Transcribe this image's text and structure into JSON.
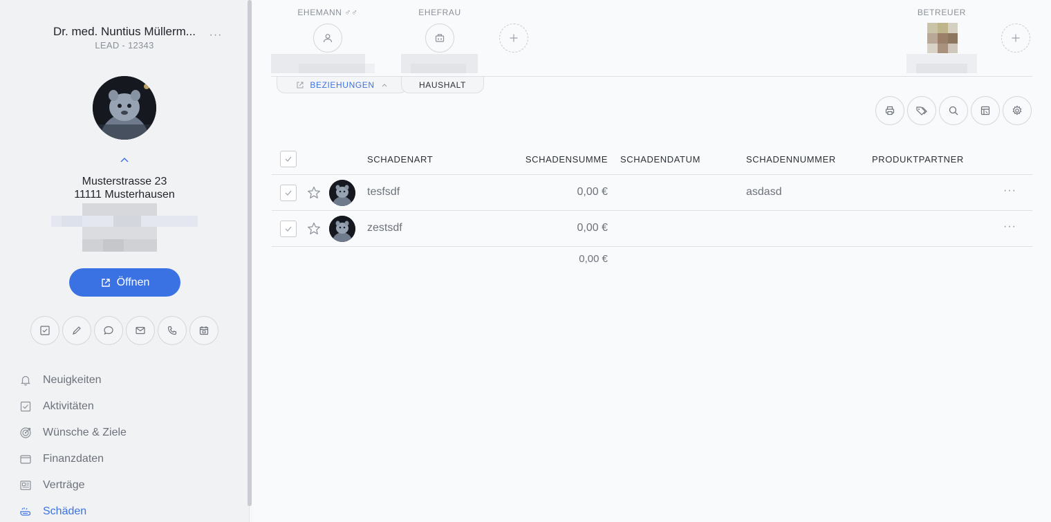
{
  "client": {
    "name": "Dr. med. Nuntius Müllerm...",
    "id": "LEAD - 12343",
    "street": "Musterstrasse 23",
    "city": "11111 Musterhausen",
    "open_label": "Öffnen"
  },
  "nav": {
    "items": [
      {
        "label": "Neuigkeiten",
        "icon": "bell-icon"
      },
      {
        "label": "Aktivitäten",
        "icon": "checkbox-icon"
      },
      {
        "label": "Wünsche & Ziele",
        "icon": "target-icon"
      },
      {
        "label": "Finanzdaten",
        "icon": "wallet-icon"
      },
      {
        "label": "Verträge",
        "icon": "contract-icon"
      },
      {
        "label": "Schäden",
        "icon": "damage-icon",
        "active": true
      }
    ]
  },
  "relations": {
    "husband_label": "EHEMANN ♂♂",
    "wife_label": "EHEFRAU",
    "advisor_label": "BETREUER"
  },
  "tabs": {
    "beziehungen": "BEZIEHUNGEN",
    "haushalt": "HAUSHALT"
  },
  "table": {
    "headers": {
      "schadenart": "SCHADENART",
      "schadensumme": "SCHADENSUMME",
      "schadendatum": "SCHADENDATUM",
      "schadennummer": "SCHADENNUMMER",
      "produktpartner": "PRODUKTPARTNER"
    },
    "rows": [
      {
        "art": "tesfsdf",
        "summe": "0,00 €",
        "datum": "",
        "nummer": "asdasd",
        "partner": ""
      },
      {
        "art": "zestsdf",
        "summe": "0,00 €",
        "datum": "",
        "nummer": "",
        "partner": ""
      }
    ],
    "total": "0,00 €"
  },
  "colors": {
    "accent": "#3b72e3",
    "sidebar_bg": "#f1f2f4",
    "main_bg": "#f9fafb"
  }
}
